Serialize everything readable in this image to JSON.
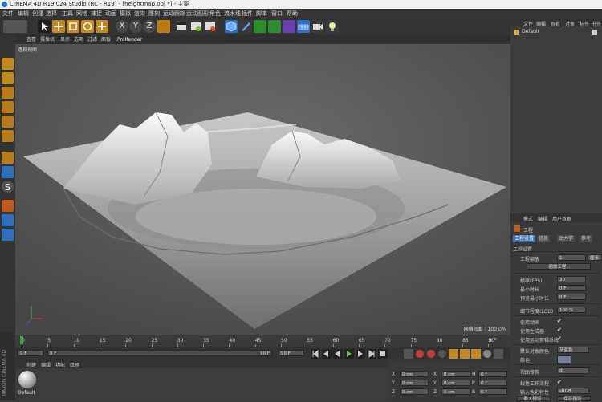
{
  "window": {
    "title": "CINEMA 4D R19.024 Studio (RC - R19) - [heightmap.obj *] - 主要"
  },
  "menu": [
    "文件",
    "编辑",
    "创建",
    "选择",
    "工具",
    "网格",
    "捕捉",
    "动画",
    "模拟",
    "渲染",
    "雕刻",
    "运动跟踪",
    "运动图形",
    "角色",
    "流水线",
    "插件",
    "脚本",
    "窗口",
    "帮助"
  ],
  "toolbar": {
    "axis_x": "X",
    "axis_y": "Y",
    "axis_z": "Z",
    "icons": [
      "undo-icon",
      "redo-icon",
      "select-icon",
      "move-icon",
      "scale-icon",
      "rotate-icon",
      "add-icon",
      "axis-x",
      "axis-y",
      "axis-z",
      "coord-icon",
      "render-view-icon",
      "render-icon",
      "render-settings-icon",
      "cube-icon",
      "pen-icon",
      "subdivide-icon",
      "cloner-icon",
      "deformer-icon",
      "floor-icon",
      "camera-icon",
      "light-icon"
    ]
  },
  "viewport": {
    "menu": [
      "查看",
      "摄像机",
      "显示",
      "选项",
      "过滤",
      "面板",
      "ProRender"
    ],
    "label": "透视视图",
    "grid_spacing": "网格间距 : 100 cm"
  },
  "timeline": {
    "ticks": [
      "0",
      "5",
      "10",
      "15",
      "20",
      "25",
      "30",
      "35",
      "40",
      "45",
      "50",
      "55",
      "60",
      "65",
      "70",
      "75",
      "80",
      "85",
      "90"
    ],
    "end_label": "0 F",
    "start_field": "0 F",
    "min_field": "0 F",
    "max_field": "90 F",
    "end_field": "90 F"
  },
  "materials": {
    "menu": [
      "创建",
      "编辑",
      "功能",
      "纹理"
    ],
    "item_label": "Default"
  },
  "coords": {
    "rows": [
      [
        "X",
        "0 cm",
        "X",
        "0 cm",
        "H",
        "0 °"
      ],
      [
        "Y",
        "0 cm",
        "Y",
        "0 cm",
        "P",
        "0 °"
      ],
      [
        "Z",
        "0 cm",
        "Z",
        "0 cm",
        "B",
        "0 °"
      ]
    ]
  },
  "object_manager": {
    "menu": [
      "文件",
      "编辑",
      "查看",
      "对象",
      "标签",
      "书签"
    ],
    "item": "Default"
  },
  "attributes": {
    "menu": [
      "模式",
      "编辑",
      "用户数据"
    ],
    "title": "工程",
    "tabs": [
      "工程设置",
      "信息",
      "动力学",
      "参考"
    ],
    "section": "工程设置",
    "scale_label": "工程缩放",
    "scale_value": "1",
    "scale_unit": "厘米",
    "scale_button": "缩放工程...",
    "fps_label": "帧率(FPS)",
    "fps_value": "30",
    "min_label": "最小时长",
    "min_value": "0 F",
    "preview_min_label": "预览最小时长",
    "preview_min_value": "0 F",
    "lod_label": "细节程度(LOD)",
    "lod_value": "100 %",
    "anim_label": "使用动画",
    "gen_label": "使用生成器",
    "motion_label": "使用运动剪辑系统",
    "default_color_label": "默认对象颜色",
    "default_color_value": "灰蓝色",
    "color_label": "颜色",
    "clip_label": "视图修剪",
    "clip_value": "中",
    "linear_label": "线性工作流程",
    "input_color_label": "输入色彩特性",
    "input_color_value": "sRGB",
    "load_button": "载入预设...",
    "save_button": "保存预设..."
  },
  "side_brand": "MAXON CINEMA 4D"
}
